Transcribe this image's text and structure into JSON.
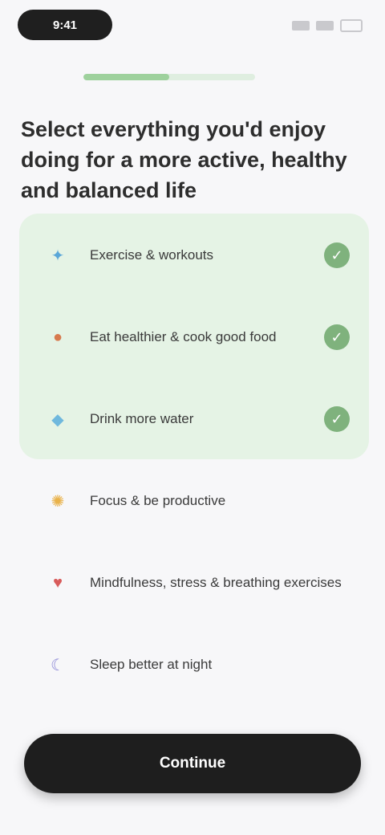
{
  "status_bar": {
    "time": "9:41",
    "icons": [
      "signal-icon",
      "wifi-icon",
      "battery-icon"
    ]
  },
  "progress": {
    "fraction": 0.5
  },
  "title": "Select everything you'd enjoy doing for a more active, healthy and balanced life",
  "options": [
    {
      "label": "Exercise & workouts",
      "icon": "dumbbell-icon",
      "glyph": "✦",
      "icon_color": "#5aa7d8",
      "selected": true
    },
    {
      "label": "Eat healthier & cook good food",
      "icon": "food-icon",
      "glyph": "●",
      "icon_color": "#d77a4e",
      "selected": true
    },
    {
      "label": "Drink more water",
      "icon": "water-drop-icon",
      "glyph": "◆",
      "icon_color": "#6fb8dd",
      "selected": true
    },
    {
      "label": "Focus & be productive",
      "icon": "sun-icon",
      "glyph": "✺",
      "icon_color": "#e9b24a",
      "selected": false
    },
    {
      "label": "Mindfulness, stress & breathing exercises",
      "icon": "heart-icon",
      "glyph": "♥",
      "icon_color": "#d85b5b",
      "selected": false
    },
    {
      "label": "Sleep better at night",
      "icon": "moon-icon",
      "glyph": "☾",
      "icon_color": "#8b86d6",
      "selected": false
    }
  ],
  "continue_label": "Continue",
  "colors": {
    "background": "#f7f7f9",
    "selected_group": "#e5f3e5",
    "check": "#7fb27d",
    "progress_fill": "#9ed19d",
    "button": "#1e1e1e"
  }
}
